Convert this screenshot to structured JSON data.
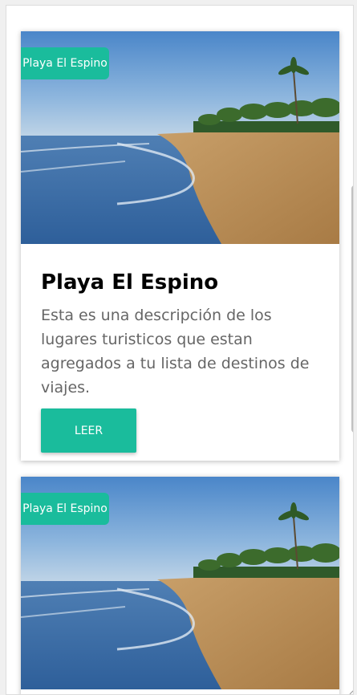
{
  "cards": [
    {
      "tag": "Playa El Espino",
      "title": "Playa El Espino",
      "description": "Esta es una descripción de los lugares turisticos que estan agregados a tu lista de destinos de viajes.",
      "button_label": "LEER",
      "image": "beach-with-palm-trees"
    },
    {
      "tag": "Playa El Espino",
      "image": "beach-with-palm-trees"
    }
  ],
  "colors": {
    "accent": "#1abc9c",
    "title_text": "#000000",
    "description_text": "#666666",
    "page_background": "#ffffff"
  }
}
